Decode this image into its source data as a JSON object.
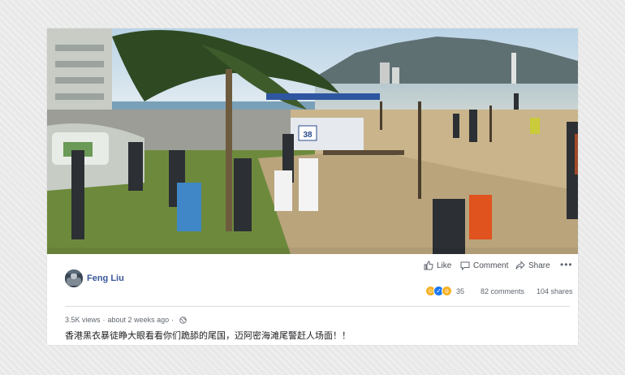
{
  "post": {
    "author": "Feng Liu",
    "views": "3.5K views",
    "time": "about 2 weeks ago",
    "meta_sep": "·",
    "caption": "香港黑衣暴徒睁大眼看看你们跪舔的尾国，迈阿密海滩尾警赶人场面！！"
  },
  "actions": {
    "like": "Like",
    "comment": "Comment",
    "share": "Share",
    "more": "•••"
  },
  "stats": {
    "reactions_count": "35",
    "comments": "82 comments",
    "shares": "104 shares"
  },
  "video": {
    "sign_number": "38"
  },
  "icons": {
    "avatar": "avatar-photo",
    "like": "thumbs-up-icon",
    "comment": "speech-bubble-icon",
    "share": "share-arrow-icon",
    "globe": "globe-icon",
    "reactions": [
      "haha-icon",
      "like-reaction-icon",
      "wow-icon"
    ]
  },
  "colors": {
    "link": "#385898",
    "text": "#1c1e21",
    "secondary": "#606770",
    "like_blue": "#1877f2",
    "reaction_yellow": "#f7b125"
  }
}
